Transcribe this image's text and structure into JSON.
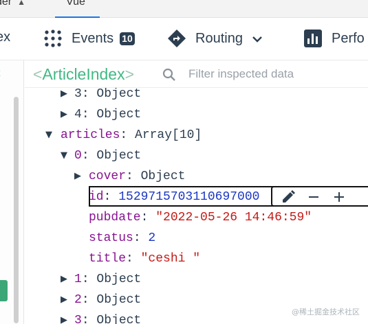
{
  "tabs": {
    "prev_partial": "der",
    "active": "Vue"
  },
  "toolbar": {
    "partial_label": "ex",
    "events_label": "Events",
    "events_count": "10",
    "routing_label": "Routing",
    "perf_partial": "Perfo"
  },
  "left_pane": {
    "partial_text": "t"
  },
  "inspector": {
    "component_open": "<",
    "component_name": "ArticleIndex",
    "component_close": ">",
    "filter_placeholder": "Filter inspected data"
  },
  "tree": {
    "rows": [
      {
        "key": "3",
        "sep": ": ",
        "value": "Object"
      },
      {
        "key": "4",
        "sep": ": ",
        "value": "Object"
      },
      {
        "key": "articles",
        "sep": ": ",
        "value": "Array[10]"
      },
      {
        "key": "0",
        "sep": ": ",
        "value": "Object"
      },
      {
        "key": "cover",
        "sep": ": ",
        "value": "Object"
      },
      {
        "key": "id",
        "sep": ": ",
        "value": "1529715703110697000"
      },
      {
        "key": "pubdate",
        "sep": ": ",
        "value": "\"2022-05-26 14:46:59\""
      },
      {
        "key": "status",
        "sep": ": ",
        "value": "2"
      },
      {
        "key": "title",
        "sep": ": ",
        "value": "\"ceshi \""
      },
      {
        "key": "1",
        "sep": ": ",
        "value": "Object"
      },
      {
        "key": "2",
        "sep": ": ",
        "value": "Object"
      },
      {
        "key": "3",
        "sep": ": ",
        "value": "Object"
      }
    ]
  },
  "watermark": "@稀土掘金技术社区",
  "icons": [
    "events-icon",
    "routing-icon",
    "chevron-down-icon",
    "performance-icon",
    "search-icon",
    "edit-icon",
    "minus-icon",
    "plus-icon"
  ],
  "colors": {
    "vue_green": "#42b883",
    "key_purple": "#881391",
    "number_blue": "#1a36c2",
    "string_red": "#c41a16"
  }
}
